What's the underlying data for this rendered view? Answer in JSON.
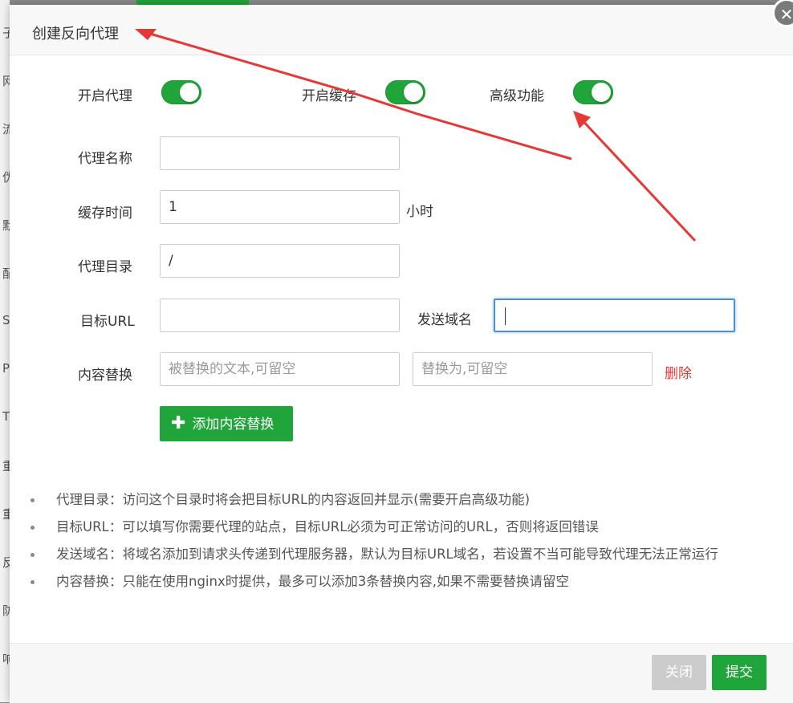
{
  "background": {
    "side_chars": [
      "子",
      "网",
      "流",
      "伪",
      "默",
      "配",
      "S",
      "P",
      "T",
      "重",
      "重",
      "反",
      "防",
      "响"
    ]
  },
  "dialog": {
    "title": "创建反向代理",
    "close_icon": "close-icon",
    "toggles": [
      {
        "label": "开启代理",
        "on": true
      },
      {
        "label": "开启缓存",
        "on": true
      },
      {
        "label": "高级功能",
        "on": true
      }
    ],
    "fields": {
      "proxy_name": {
        "label": "代理名称",
        "value": ""
      },
      "cache_time": {
        "label": "缓存时间",
        "value": "1",
        "unit": "小时"
      },
      "proxy_dir": {
        "label": "代理目录",
        "value": "/"
      },
      "target_url": {
        "label": "目标URL",
        "value": ""
      },
      "send_domain": {
        "label": "发送域名",
        "value": ""
      },
      "content_replace": {
        "label": "内容替换",
        "from_placeholder": "被替换的文本,可留空",
        "to_placeholder": "替换为,可留空",
        "delete_label": "删除"
      }
    },
    "add_replace_label": "添加内容替换",
    "help": [
      "代理目录：访问这个目录时将会把目标URL的内容返回并显示(需要开启高级功能)",
      "目标URL：可以填写你需要代理的站点，目标URL必须为可正常访问的URL，否则将返回错误",
      "发送域名：将域名添加到请求头传递到代理服务器，默认为目标URL域名，若设置不当可能导致代理无法正常运行",
      "内容替换：只能在使用nginx时提供，最多可以添加3条替换内容,如果不需要替换请留空"
    ],
    "footer": {
      "close_label": "关闭",
      "submit_label": "提交"
    }
  },
  "colors": {
    "accent": "#20a53a",
    "annotation": "#e53935",
    "focus": "#4a90d9"
  }
}
